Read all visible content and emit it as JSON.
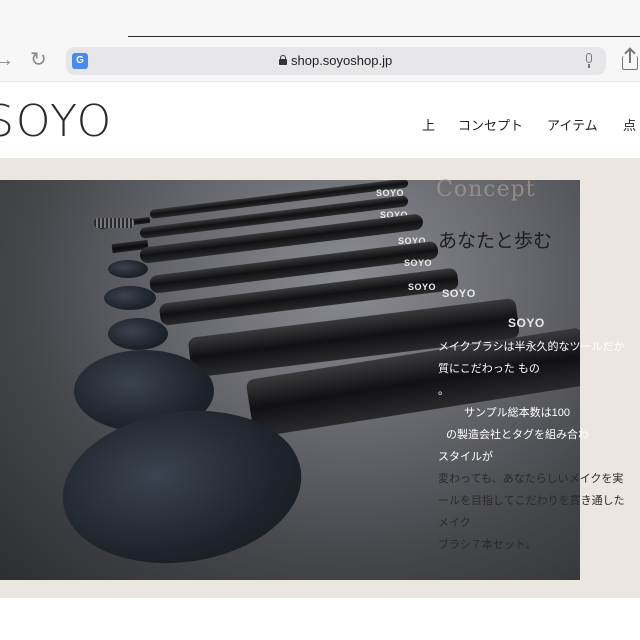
{
  "browser": {
    "url": "shop.soyoshop.jp",
    "translate_glyph": "G",
    "icons": [
      "back-arrow-icon",
      "reload-icon",
      "translate-icon",
      "lock-icon",
      "microphone-icon",
      "share-icon"
    ]
  },
  "site": {
    "logo": "SOYO",
    "nav": [
      "上",
      "コンセプト",
      "アイテム",
      "点"
    ]
  },
  "photo": {
    "brand_marks": [
      "SOYO",
      "SOYO",
      "SOYO",
      "SOYO",
      "SOYO",
      "SOYO",
      "SOYO"
    ]
  },
  "concept": {
    "ghost_title": "Concept",
    "headline": "あなたと歩む",
    "lines": [
      "メイクブラシは半永久的なツールだか",
      "質にこだわった もの",
      "。",
      "サンプル総本数は100",
      "の製造会社とタグを組み合わ",
      "スタイルが",
      "変わっても、あなたらしいメイクを実",
      "ールを目指してこだわりを貫き通した",
      "メイク",
      "ブラシ７本セット。"
    ]
  },
  "colors": {
    "content_bg": "#ebe7e0",
    "ghost_text": "#a79d90"
  }
}
